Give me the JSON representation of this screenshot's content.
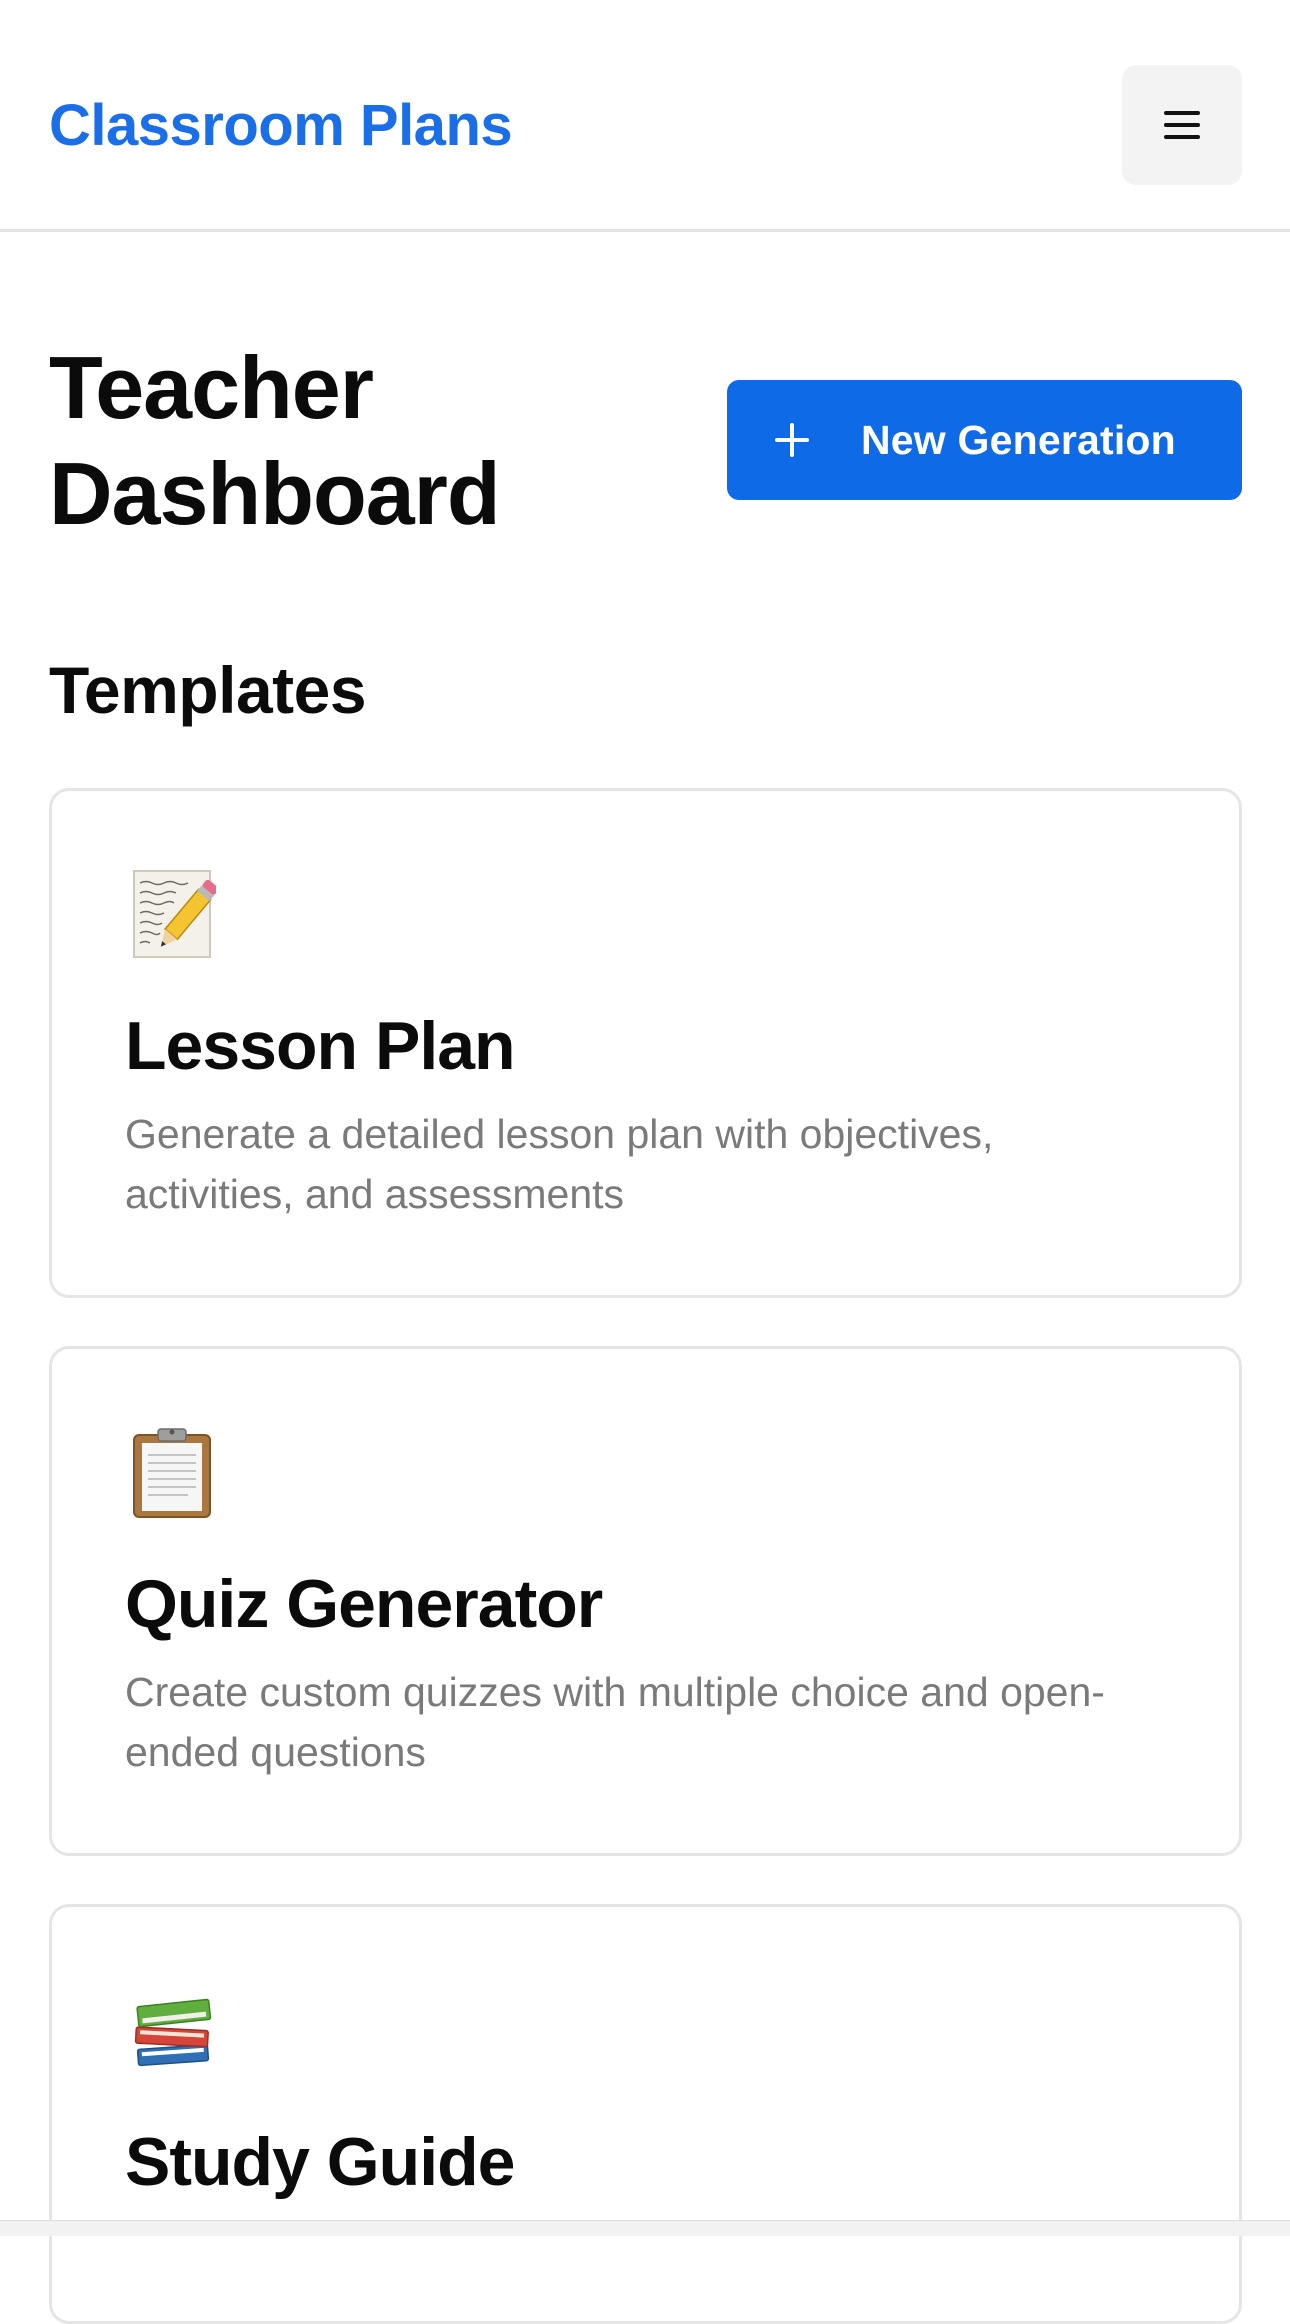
{
  "header": {
    "brand": "Classroom Plans",
    "menu_icon": "hamburger-menu-icon"
  },
  "page": {
    "title": "Teacher Dashboard",
    "new_generation_label": "New Generation",
    "new_generation_icon": "plus-icon"
  },
  "templates": {
    "heading": "Templates",
    "items": [
      {
        "icon": "memo-pencil-icon",
        "title": "Lesson Plan",
        "description": "Generate a detailed lesson plan with objectives, activities, and assessments"
      },
      {
        "icon": "clipboard-icon",
        "title": "Quiz Generator",
        "description": "Create custom quizzes with multiple choice and open-ended questions"
      },
      {
        "icon": "books-icon",
        "title": "Study Guide",
        "description": ""
      }
    ]
  },
  "colors": {
    "brand": "#1a6ee8",
    "primary_button": "#0f6ae8",
    "muted_text": "#7a7a7a",
    "card_border": "#e5e5e5"
  }
}
